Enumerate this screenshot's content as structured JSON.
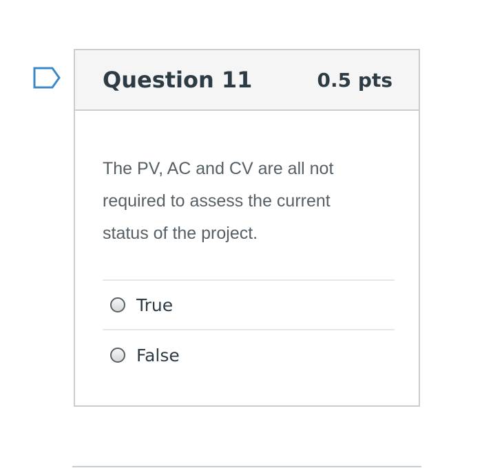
{
  "question": {
    "flag_icon": "flag-outline-icon",
    "title": "Question 11",
    "points": "0.5 pts",
    "text": "The PV, AC and CV are all not required to assess the current status of the project.",
    "answers": [
      {
        "label": "True",
        "selected": false
      },
      {
        "label": "False",
        "selected": false
      }
    ]
  },
  "colors": {
    "flag": "#3b88c9",
    "heading": "#2d3b45",
    "body_text": "#555f66",
    "border": "#c7cdd1",
    "header_background": "#f5f5f5"
  }
}
